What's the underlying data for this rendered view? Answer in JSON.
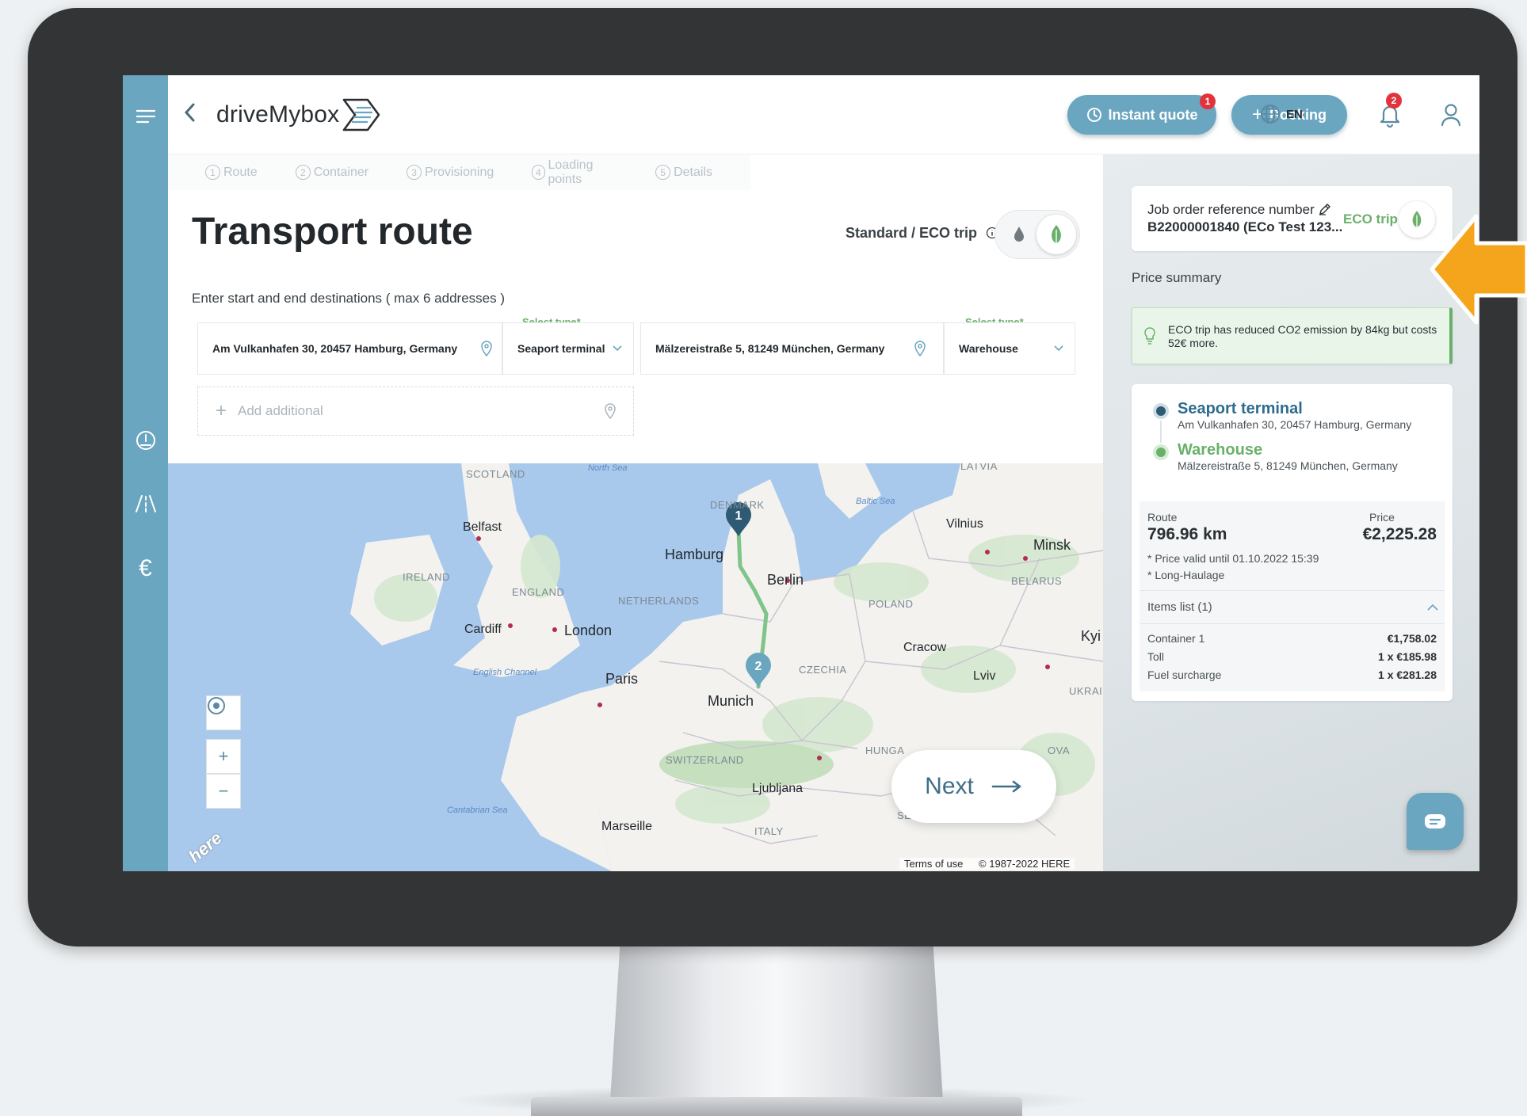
{
  "header": {
    "logo_text": "driveMybox",
    "instant_quote_label": "Instant quote",
    "instant_quote_badge": "1",
    "booking_label": "Booking",
    "notifications_badge": "2",
    "language": "EN"
  },
  "steps": [
    {
      "num": "1",
      "label": "Route"
    },
    {
      "num": "2",
      "label": "Container"
    },
    {
      "num": "3",
      "label": "Provisioning"
    },
    {
      "num": "4",
      "label": "Loading points"
    },
    {
      "num": "5",
      "label": "Details"
    }
  ],
  "main": {
    "title": "Transport route",
    "eco_toggle_label": "Standard / ECO trip",
    "instruction": "Enter start and end destinations ( max 6 addresses )",
    "origin_address": "Am Vulkanhafen 30, 20457 Hamburg, Germany",
    "origin_type_label": "Select type*",
    "origin_type": "Seaport terminal",
    "destination_address": "Mälzereistraße 5, 81249 München, Germany",
    "destination_type_label": "Select type*",
    "destination_type": "Warehouse",
    "add_additional": "Add additional",
    "next_label": "Next"
  },
  "map": {
    "cities": [
      "Belfast",
      "Hamburg",
      "Berlin",
      "London",
      "Cardiff",
      "Paris",
      "Munich",
      "Ljubljana",
      "Marseille",
      "Vilnius",
      "Minsk",
      "Cracow",
      "Lviv",
      "Kyi"
    ],
    "countries": [
      "SCOTLAND",
      "IRELAND",
      "ENGLAND",
      "NETHERLANDS",
      "DENMARK",
      "POLAND",
      "CZECHIA",
      "BELARUS",
      "LATVIA",
      "UKRAI",
      "HUNGA",
      "SWITZERLAND",
      "ITALY",
      "SERBIA",
      "OVA"
    ],
    "seas": [
      "North Sea",
      "Baltic Sea",
      "English Channel",
      "Cantabrian Sea"
    ],
    "marker_1": "1",
    "marker_2": "2",
    "zoom_in": "+",
    "zoom_out": "−",
    "brand": "here",
    "terms": "Terms of use",
    "copyright": "© 1987-2022 HERE"
  },
  "summary": {
    "job_ref_label": "Job order reference number",
    "job_ref_value": "B22000001840 (ECo Test 123...",
    "eco_trip_label": "ECO trip",
    "price_summary_label": "Price summary",
    "eco_notice": "ECO trip has reduced CO2 emission by 84kg but costs 52€ more.",
    "origin_type": "Seaport terminal",
    "origin_address": "Am Vulkanhafen 30, 20457 Hamburg, Germany",
    "destination_type": "Warehouse",
    "destination_address": "Mälzereistraße 5, 81249 München, Germany",
    "route_label": "Route",
    "route_value": "796.96 km",
    "price_label": "Price",
    "price_value": "€2,225.28",
    "price_valid": "* Price valid until 01.10.2022 15:39",
    "long_haulage": "* Long-Haulage",
    "items_list_label": "Items list (1)",
    "items": [
      {
        "name": "Container 1",
        "value": "€1,758.02"
      },
      {
        "name": "Toll",
        "value": "1 x €185.98"
      },
      {
        "name": "Fuel surcharge",
        "value": "1 x €281.28"
      }
    ]
  },
  "colors": {
    "primary": "#6aa6bf",
    "eco_green": "#6ab06a",
    "badge_red": "#e2333c",
    "accent_arrow": "#f5a51c",
    "dark_marker": "#2e5a73"
  }
}
